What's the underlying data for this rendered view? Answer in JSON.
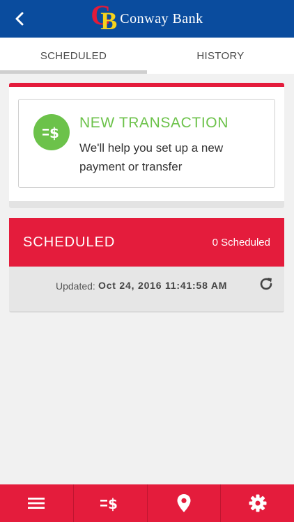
{
  "header": {
    "logo_letter_c": "C",
    "logo_letter_b": "B",
    "bank_name": "Conway Bank",
    "back_icon": "chevron-left-icon"
  },
  "tabs": [
    {
      "label": "SCHEDULED",
      "active": true
    },
    {
      "label": "HISTORY",
      "active": false
    }
  ],
  "new_transaction": {
    "title": "NEW TRANSACTION",
    "description": "We'll help you set up a new payment or transfer",
    "icon": "transfer-dollar-icon"
  },
  "scheduled": {
    "title": "SCHEDULED",
    "count_text": "0 Scheduled",
    "updated_label": "Updated:",
    "updated_value": "Oct 24, 2016 11:41:58 AM",
    "refresh_icon": "refresh-icon"
  },
  "bottom_nav": [
    {
      "icon": "menu-icon"
    },
    {
      "icon": "transfer-dollar-icon"
    },
    {
      "icon": "location-pin-icon"
    },
    {
      "icon": "gear-icon"
    }
  ],
  "colors": {
    "header_blue": "#0a4c9e",
    "accent_red": "#e41c3c",
    "accent_green": "#6cc24a",
    "logo_yellow": "#f6d21c"
  }
}
